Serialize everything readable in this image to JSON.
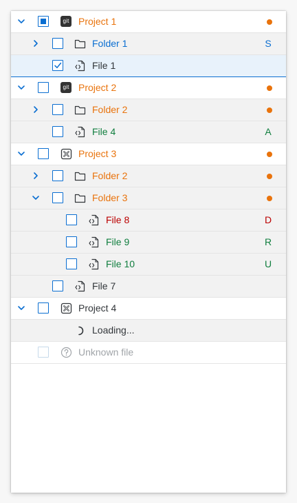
{
  "colors": {
    "orange": "#e9730c",
    "blue": "#0a6ed1",
    "green": "#107e3e",
    "red": "#bb0000",
    "dark": "#32363a",
    "disabled": "#a0a4a8"
  },
  "tree": [
    {
      "key": "project1",
      "label": "Project 1",
      "icon": "git-icon",
      "expanded": true,
      "checkbox": "partial",
      "color": "orange",
      "status": "modified-dot"
    },
    {
      "key": "folder1",
      "label": "Folder 1",
      "icon": "folder-icon",
      "expanded": false,
      "checkbox": "unchecked",
      "color": "blue",
      "status": "S"
    },
    {
      "key": "file1",
      "label": "File 1",
      "icon": "file-code-icon",
      "checkbox": "checked",
      "color": "dark",
      "selected": true
    },
    {
      "key": "project2",
      "label": "Project 2",
      "icon": "git-icon",
      "expanded": true,
      "checkbox": "unchecked",
      "color": "orange",
      "status": "modified-dot"
    },
    {
      "key": "folder2a",
      "label": "Folder 2",
      "icon": "folder-icon",
      "expanded": false,
      "checkbox": "unchecked",
      "color": "orange",
      "status": "modified-dot"
    },
    {
      "key": "file4",
      "label": "File 4",
      "icon": "file-code-icon",
      "checkbox": "unchecked",
      "color": "green",
      "status": "A"
    },
    {
      "key": "project3",
      "label": "Project 3",
      "icon": "no-repo-icon",
      "expanded": true,
      "checkbox": "unchecked",
      "color": "orange",
      "status": "modified-dot"
    },
    {
      "key": "folder2b",
      "label": "Folder 2",
      "icon": "folder-icon",
      "expanded": false,
      "checkbox": "unchecked",
      "color": "orange",
      "status": "modified-dot"
    },
    {
      "key": "folder3",
      "label": "Folder 3",
      "icon": "folder-icon",
      "expanded": true,
      "checkbox": "unchecked",
      "color": "orange",
      "status": "modified-dot"
    },
    {
      "key": "file8",
      "label": "File 8",
      "icon": "file-code-icon",
      "checkbox": "unchecked",
      "color": "red",
      "status": "D"
    },
    {
      "key": "file9",
      "label": "File 9",
      "icon": "file-code-icon",
      "checkbox": "unchecked",
      "color": "green",
      "status": "R"
    },
    {
      "key": "file10",
      "label": "File 10",
      "icon": "file-code-icon",
      "checkbox": "unchecked",
      "color": "green",
      "status": "U"
    },
    {
      "key": "file7",
      "label": "File 7",
      "icon": "file-code-icon",
      "checkbox": "unchecked",
      "color": "dark"
    },
    {
      "key": "project4",
      "label": "Project 4",
      "icon": "no-repo-icon",
      "expanded": true,
      "checkbox": "unchecked",
      "color": "dark"
    },
    {
      "key": "loading",
      "label": "Loading...",
      "icon": "spinner-icon",
      "color": "dark"
    },
    {
      "key": "unknown",
      "label": "Unknown file",
      "icon": "question-mark-icon",
      "checkbox": "disabled",
      "color": "disabled"
    }
  ]
}
